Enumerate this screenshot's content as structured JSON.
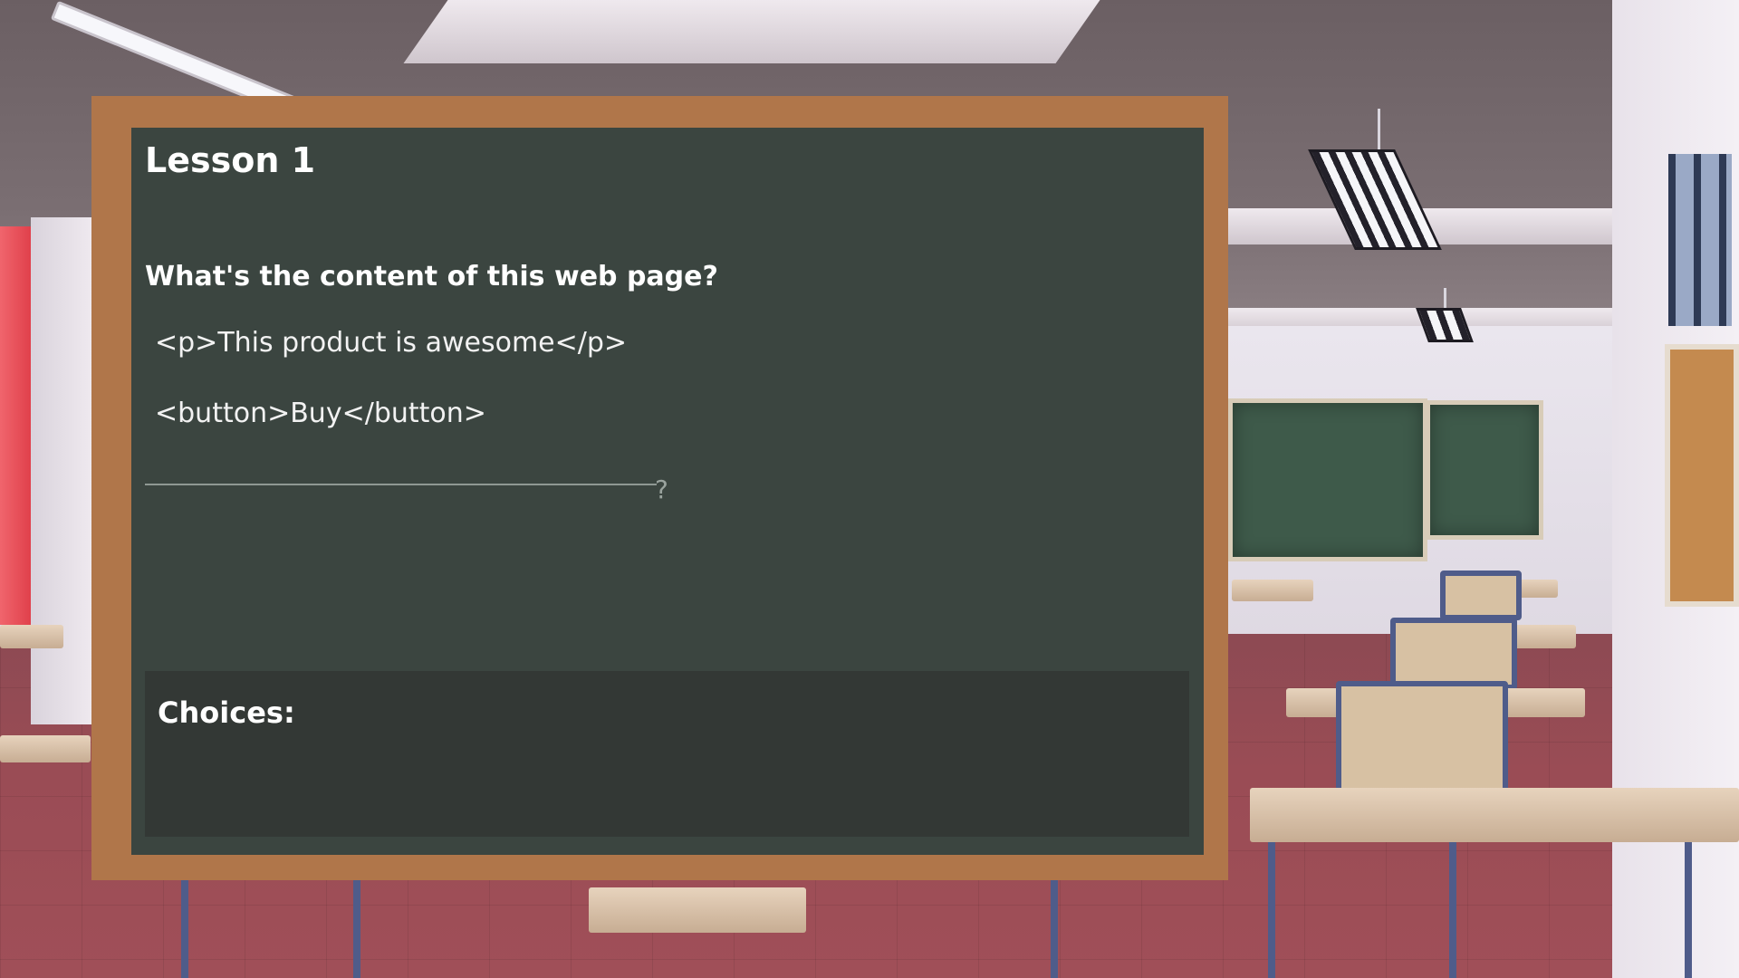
{
  "lesson": {
    "title": "Lesson 1",
    "question": "What's the content of this web page?",
    "code_lines": [
      "<p>This product is awesome</p>",
      "<button>Buy</button>"
    ],
    "answer_suffix": "?",
    "choices_label": "Choices:"
  },
  "colors": {
    "board": "#3b4540",
    "frame": "#b0764a",
    "choices_panel": "#333835"
  }
}
